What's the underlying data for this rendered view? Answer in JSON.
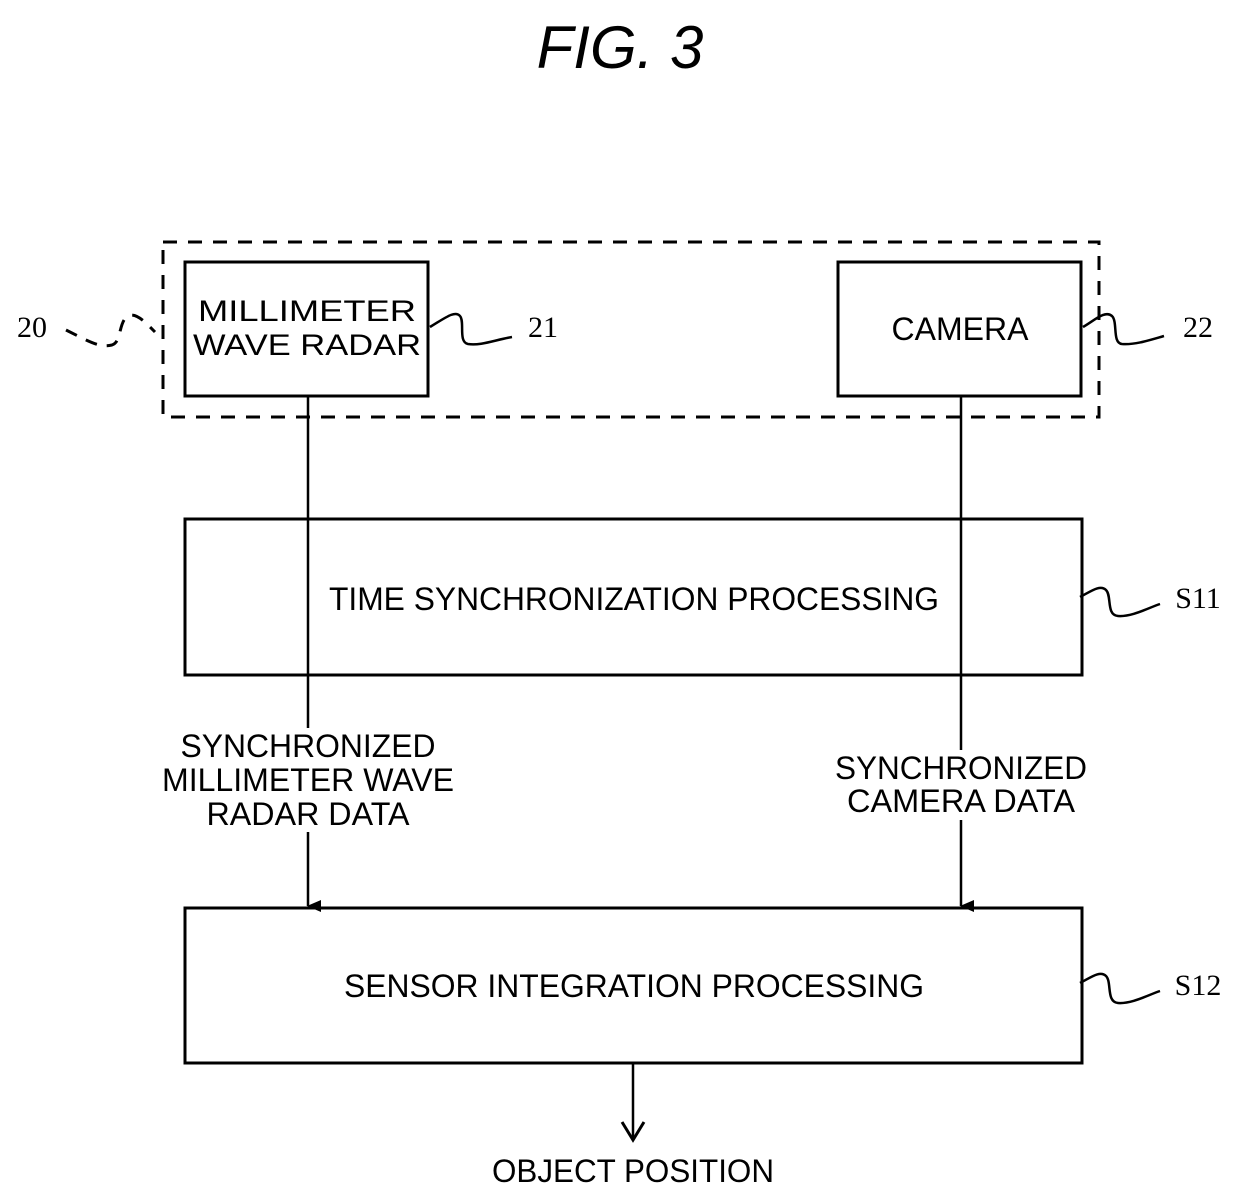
{
  "figure": {
    "title": "FIG. 3"
  },
  "group": {
    "ref": "20"
  },
  "nodes": {
    "radar": {
      "lines": [
        "MILLIMETER",
        "WAVE RADAR"
      ],
      "ref": "21"
    },
    "camera": {
      "lines": [
        "CAMERA"
      ],
      "ref": "22"
    },
    "time_sync": {
      "label": "TIME SYNCHRONIZATION PROCESSING",
      "ref": "S11"
    },
    "sensor_integration": {
      "label": "SENSOR INTEGRATION PROCESSING",
      "ref": "S12"
    }
  },
  "edges": {
    "radar_data": {
      "lines": [
        "SYNCHRONIZED",
        "MILLIMETER WAVE",
        "RADAR DATA"
      ]
    },
    "camera_data": {
      "lines": [
        "SYNCHRONIZED",
        "CAMERA DATA"
      ]
    },
    "output": {
      "label": "OBJECT POSITION"
    }
  },
  "colors": {
    "stroke": "#000000",
    "background": "#ffffff"
  }
}
